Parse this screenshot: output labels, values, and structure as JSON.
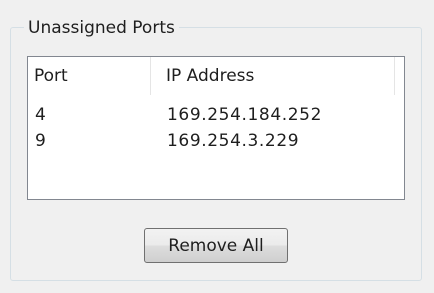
{
  "group": {
    "title": "Unassigned Ports"
  },
  "table": {
    "columns": [
      "Port",
      "IP Address"
    ],
    "rows": [
      {
        "port": "4",
        "ip": "169.254.184.252"
      },
      {
        "port": "9",
        "ip": "169.254.3.229"
      }
    ]
  },
  "buttons": {
    "remove_all": "Remove All"
  }
}
